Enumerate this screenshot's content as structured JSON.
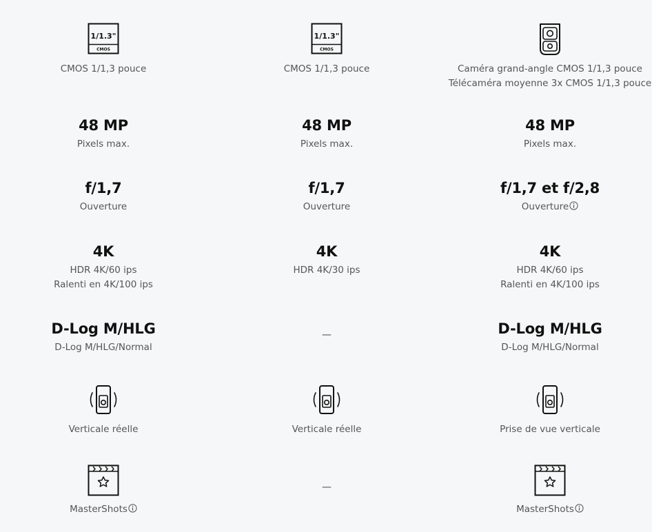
{
  "icons": {
    "sensor": "sensor-1-1.3-icon",
    "dual_camera": "dual-camera-icon",
    "vertical": "vertical-phone-icon",
    "mastershots": "clapperboard-star-icon",
    "info": "info-icon"
  },
  "sensor_badge": {
    "size": "1/1.3\"",
    "type": "CMOS"
  },
  "columns": [
    {
      "sensor": "CMOS 1/1,3 pouce",
      "pixels": {
        "value": "48 MP",
        "label": "Pixels max."
      },
      "aperture": {
        "value": "f/1,7",
        "label": "Ouverture"
      },
      "video": {
        "value": "4K",
        "line1": "HDR 4K/60 ips",
        "line2": "Ralenti en 4K/100 ips"
      },
      "color": {
        "value": "D-Log M/HLG",
        "label": "D-Log M/HLG/Normal"
      },
      "vertical": "Verticale réelle",
      "mastershots": "MasterShots"
    },
    {
      "sensor": "CMOS 1/1,3 pouce",
      "pixels": {
        "value": "48 MP",
        "label": "Pixels max."
      },
      "aperture": {
        "value": "f/1,7",
        "label": "Ouverture"
      },
      "video": {
        "value": "4K",
        "line1": "HDR 4K/30 ips"
      },
      "color": {
        "dash": "—"
      },
      "vertical": "Verticale réelle",
      "mastershots": {
        "dash": "—"
      }
    },
    {
      "sensor_line1": "Caméra grand-angle CMOS 1/1,3 pouce",
      "sensor_line2": "Télécaméra moyenne 3x CMOS 1/1,3 pouce",
      "pixels": {
        "value": "48 MP",
        "label": "Pixels max."
      },
      "aperture": {
        "value": "f/1,7 et f/2,8",
        "label": "Ouverture"
      },
      "video": {
        "value": "4K",
        "line1": "HDR 4K/60 ips",
        "line2": "Ralenti en 4K/100 ips"
      },
      "color": {
        "value": "D-Log M/HLG",
        "label": "D-Log M/HLG/Normal"
      },
      "vertical": "Prise de vue verticale",
      "mastershots": "MasterShots"
    }
  ]
}
